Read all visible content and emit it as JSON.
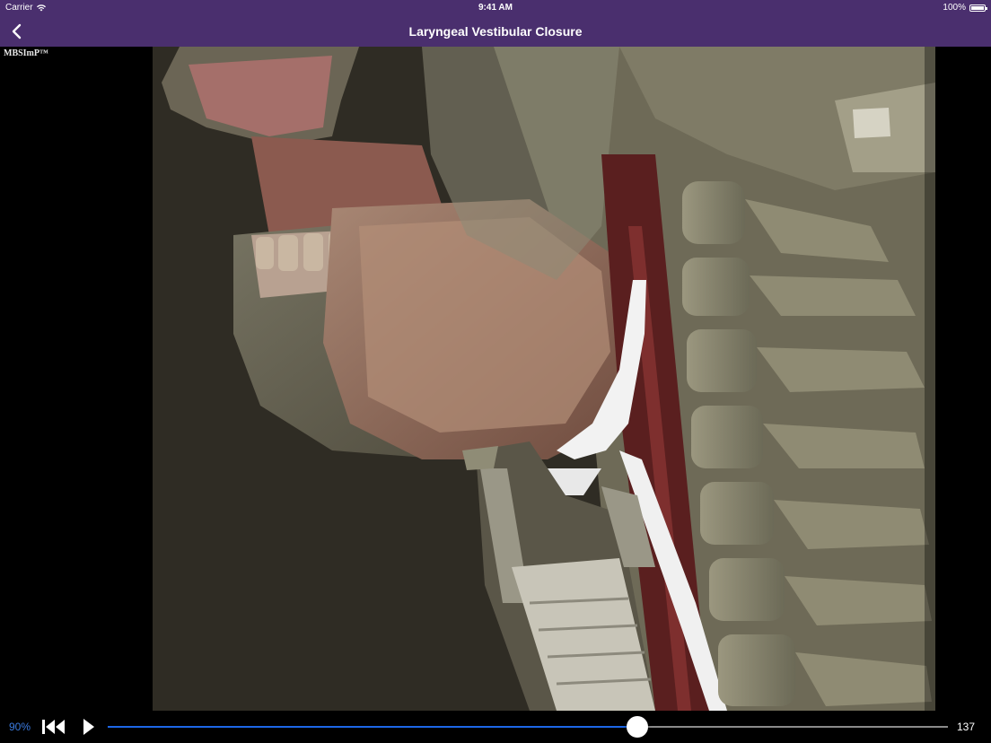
{
  "status_bar": {
    "carrier": "Carrier",
    "time": "9:41 AM",
    "battery": "100%",
    "icons": [
      "wifi-icon",
      "battery-icon"
    ]
  },
  "nav": {
    "title": "Laryngeal Vestibular Closure",
    "back_icon": "chevron-left-icon"
  },
  "video": {
    "watermark": "MBSImP™",
    "content": "3D anatomical animation of head and neck in sagittal view"
  },
  "player": {
    "speed": "90%",
    "frame_count": "137",
    "progress": 0.63,
    "icons": [
      "rewind-to-start-icon",
      "play-icon"
    ]
  },
  "colors": {
    "nav_bg": "#4a2f6e",
    "accent": "#3b7be0",
    "progress_fill": "#1d67e6"
  }
}
